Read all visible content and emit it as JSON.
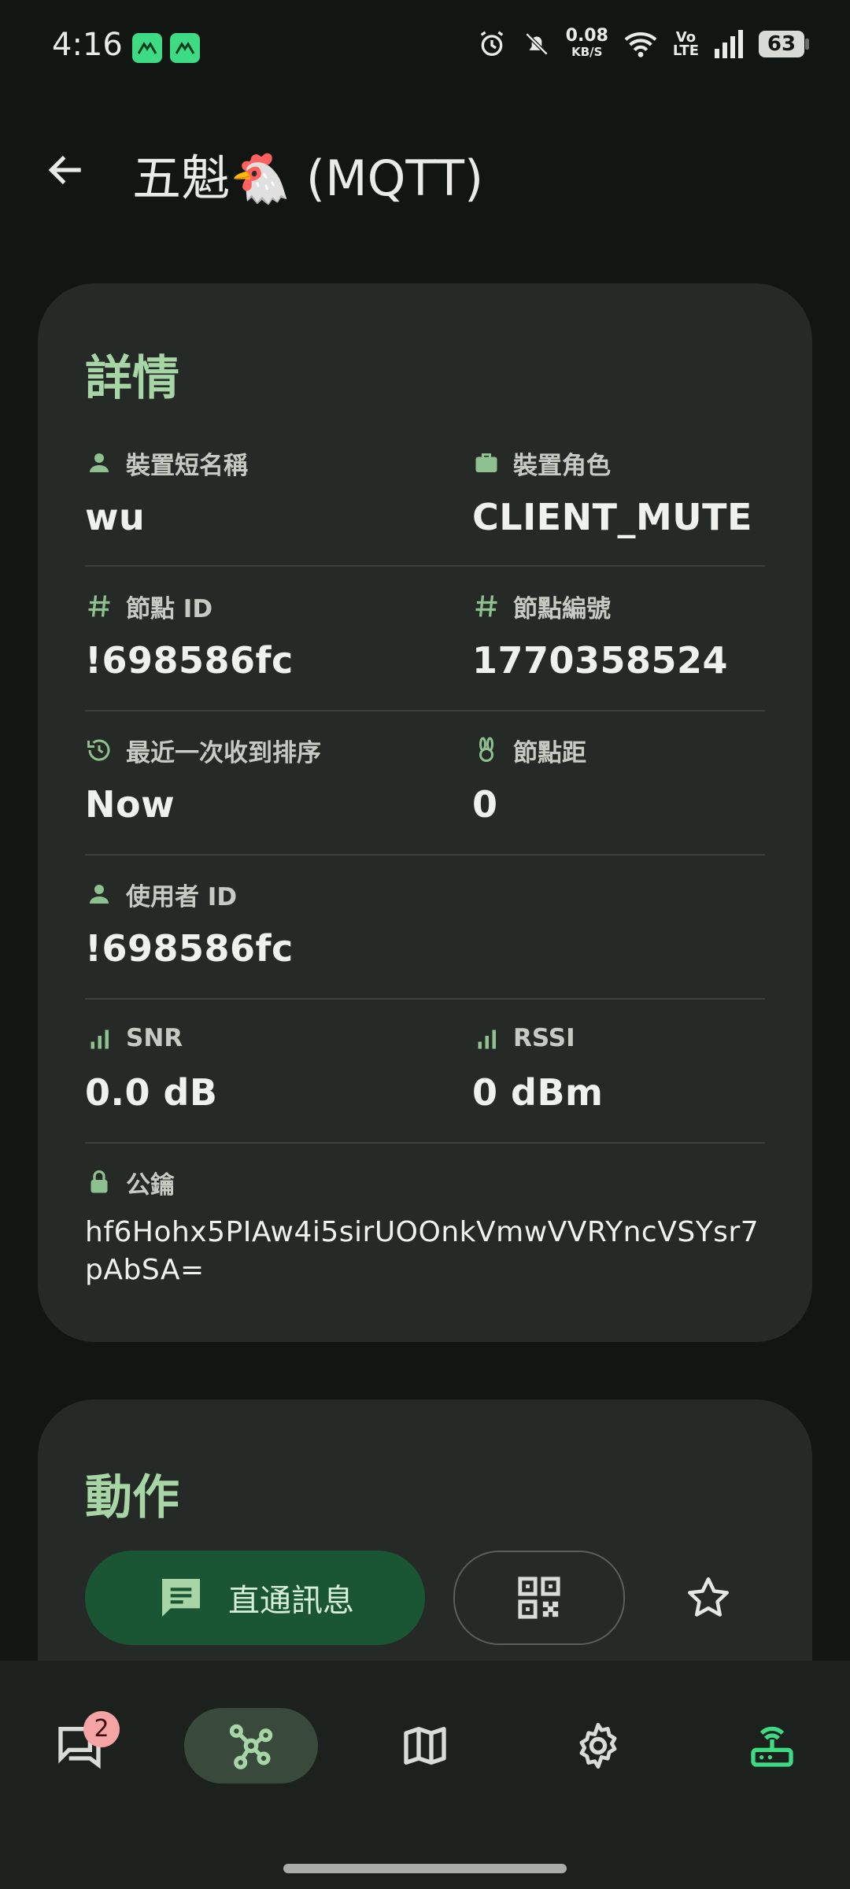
{
  "status_bar": {
    "time": "4:16",
    "net_speed": "0.08",
    "net_unit": "KB/S",
    "volte_top": "Vo",
    "volte_bottom": "LTE",
    "battery": "63"
  },
  "app_bar": {
    "title": "五魁🐔 (MQTT)",
    "back_icon": "arrow-back-icon"
  },
  "details": {
    "heading": "詳情",
    "short_name_label": "裝置短名稱",
    "short_name_value": "wu",
    "role_label": "裝置角色",
    "role_value": "CLIENT_MUTE",
    "node_id_label": "節點 ID",
    "node_id_value": "!698586fc",
    "node_num_label": "節點編號",
    "node_num_value": "1770358524",
    "last_heard_label": "最近一次收到排序",
    "last_heard_value": "Now",
    "hops_label": "節點距",
    "hops_value": "0",
    "user_id_label": "使用者 ID",
    "user_id_value": "!698586fc",
    "snr_label": "SNR",
    "snr_value": "0.0 dB",
    "rssi_label": "RSSI",
    "rssi_value": "0 dBm",
    "public_key_label": "公鑰",
    "public_key_value": "hf6Hohx5PIAw4i5sirUOOnkVmwVVRYncVSYsr7pAbSA="
  },
  "actions": {
    "heading": "動作",
    "direct_message_label": "直通訊息"
  },
  "bottom_nav": {
    "messages_badge": "2",
    "items": [
      "messages",
      "nodes",
      "map",
      "settings",
      "connections"
    ]
  },
  "colors": {
    "background": "#121612",
    "card": "#252a26",
    "accent": "#a7d5a6",
    "button": "#1a5634",
    "connected": "#3ddc84"
  }
}
